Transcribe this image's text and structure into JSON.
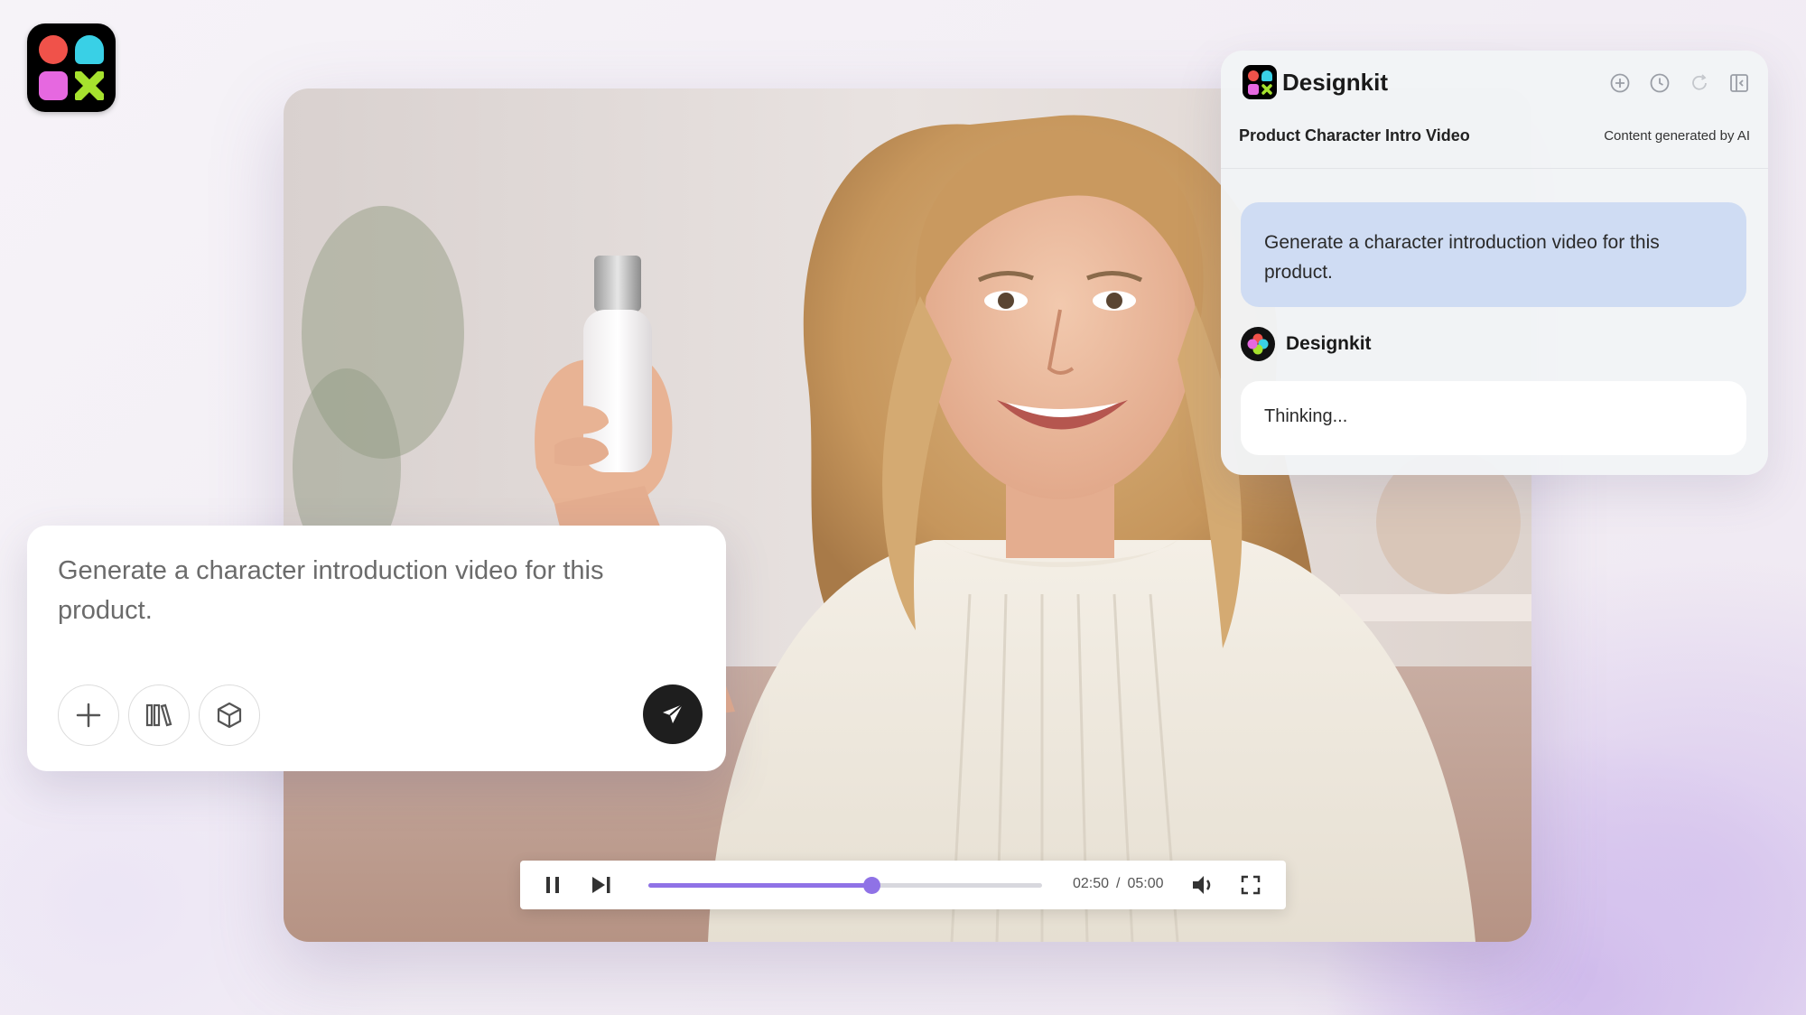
{
  "brand": {
    "name": "Designkit",
    "logo_icon": "designkit-logo-icon"
  },
  "player": {
    "current_time": "02:50",
    "separator": "/",
    "duration": "05:00",
    "progress_fraction": 0.567,
    "accent_color": "#8f72e6"
  },
  "prompt": {
    "text": "Generate a character introduction video for this product.",
    "tools": [
      "plus-icon",
      "library-icon",
      "cube-icon"
    ],
    "send_icon": "send-icon"
  },
  "chat": {
    "brand": "Designkit",
    "title": "Product Character Intro Video",
    "ai_note": "Content generated by AI",
    "header_icons": [
      "new-chat-icon",
      "history-icon",
      "refresh-icon",
      "panel-toggle-icon"
    ],
    "user_message": "Generate a character introduction video for this product.",
    "bot_name": "Designkit",
    "bot_message": "Thinking..."
  }
}
